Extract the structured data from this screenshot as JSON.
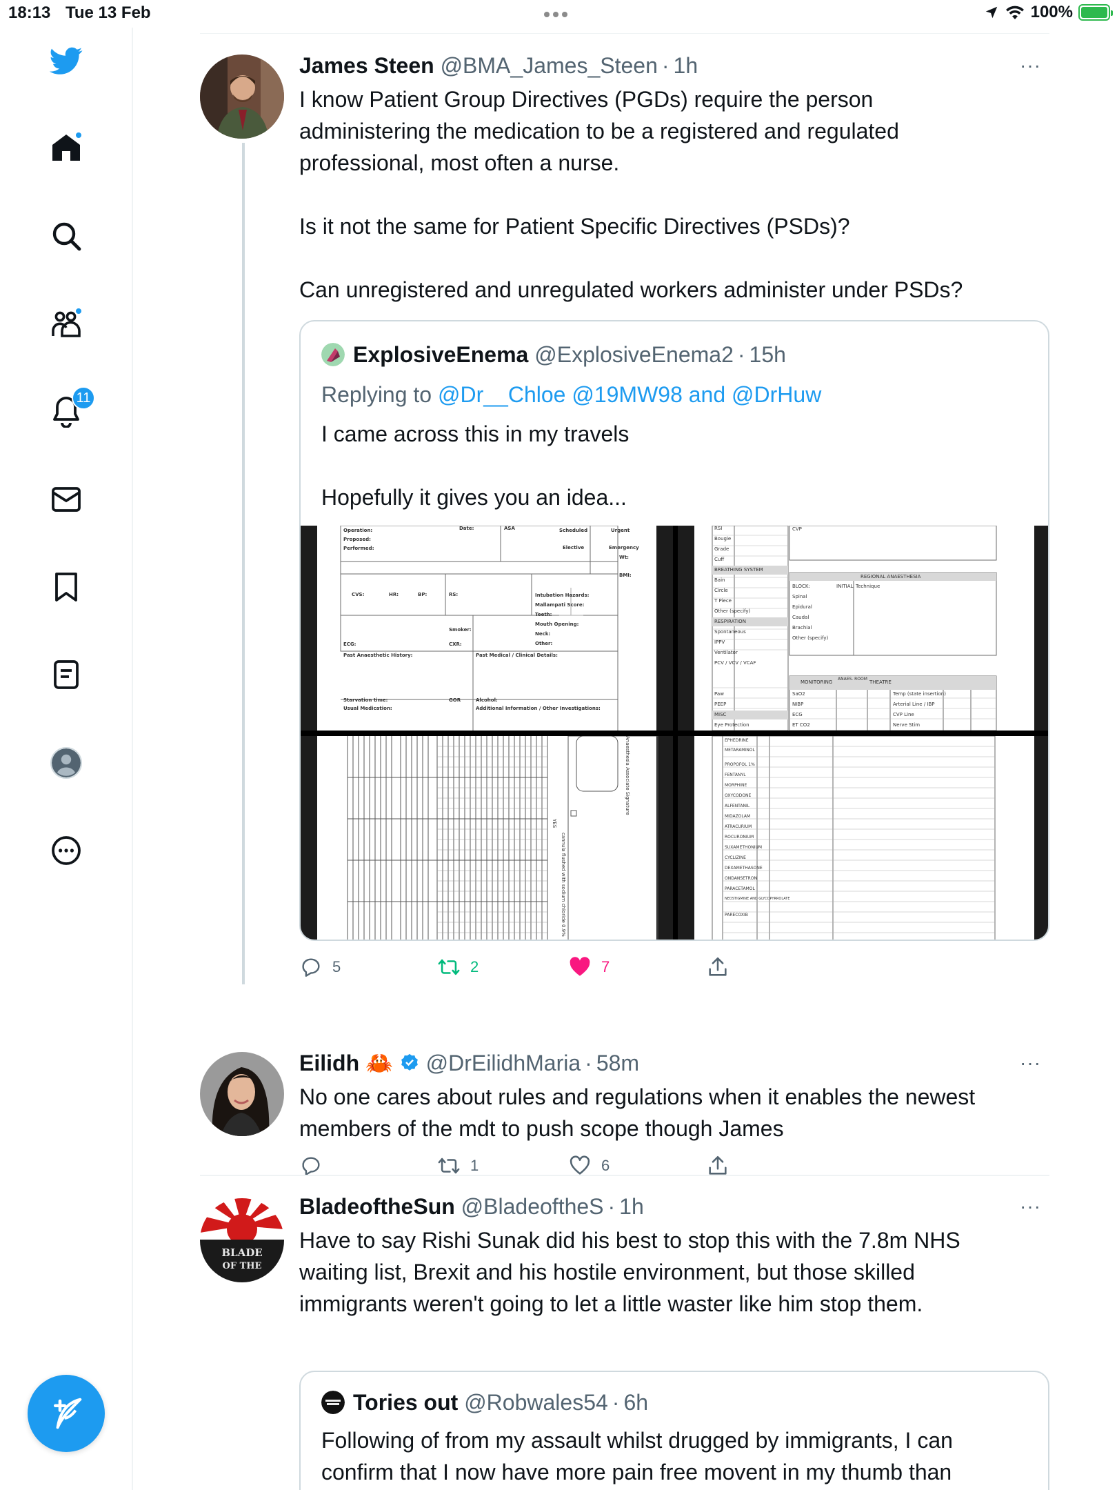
{
  "status_bar": {
    "time": "18:13",
    "date": "Tue 13 Feb",
    "battery": "100%",
    "battery_level": 1.0,
    "accent": "#2db94d"
  },
  "sidebar": {
    "items": [
      {
        "icon": "twitter-logo-icon"
      },
      {
        "icon": "home-icon",
        "has_dot": true
      },
      {
        "icon": "search-icon"
      },
      {
        "icon": "communities-icon",
        "has_dot": true
      },
      {
        "icon": "notifications-icon",
        "badge": "11"
      },
      {
        "icon": "messages-icon"
      },
      {
        "icon": "bookmark-icon"
      },
      {
        "icon": "lists-icon"
      },
      {
        "icon": "profile-icon"
      },
      {
        "icon": "more-icon"
      }
    ],
    "compose_icon": "compose-icon",
    "accent": "#1d9bf0"
  },
  "tweets": [
    {
      "name": "James Steen",
      "handle": "@BMA_James_Steen",
      "sep": "·",
      "time": "1h",
      "more": "···",
      "text": "I know Patient Group Directives (PGDs) require the person\nadministering the medication to be a registered and regulated\nprofessional, most often a nurse.\n\nIs it not the same for Patient Specific Directives (PSDs)?\n\nCan unregistered and unregulated workers administer under PSDs?",
      "quote": {
        "name": "ExplosiveEnema",
        "handle": "@ExplosiveEnema2",
        "sep": "·",
        "time": "15h",
        "replying_prefix": "Replying to",
        "replying_mentions": "@Dr__Chloe @19MW98 and @DrHuw",
        "text": "I came across this in my travels\n\nHopefully it gives you an idea..."
      },
      "actions": {
        "replies": "5",
        "retweets": "2",
        "likes": "7"
      }
    },
    {
      "name": "Eilidh",
      "emoji": "🦀",
      "verified": true,
      "handle": "@DrEilidhMaria",
      "sep": "·",
      "time": "58m",
      "more": "···",
      "text": "No one cares about rules and regulations when it enables the newest\nmembers of the mdt to push scope though James",
      "actions": {
        "replies": "",
        "retweets": "1",
        "likes": "6"
      }
    },
    {
      "name": "BladeoftheSun",
      "handle": "@BladeoftheS",
      "sep": "·",
      "time": "1h",
      "more": "···",
      "avatar_text": "BLADE OF THE",
      "text": "Have to say Rishi Sunak did his best to stop this with the 7.8m NHS\nwaiting list, Brexit and his hostile environment, but those skilled\nimmigrants weren't going to let a little waster like him stop them.",
      "quote": {
        "name": "Tories out",
        "handle": "@Robwales54",
        "sep": "·",
        "time": "6h",
        "text": "Following of from my assault whilst drugged by immigrants, I can\nconfirm that I now have more pain free movent in my thumb than\nI've had for years"
      }
    }
  ],
  "media_form": {
    "left_top": [
      "Operation:",
      "Proposed:",
      "Performed:",
      "Date:",
      "ASA",
      "Scheduled",
      "Urgent",
      "Elective",
      "Emergency",
      "Wt:",
      "BMI:",
      "CVS:",
      "HR:",
      "BP:",
      "RS:",
      "Intubation Hazards:",
      "Mallampati Score:",
      "Teeth:",
      "Mouth Opening:",
      "Neck:",
      "Other:",
      "Smoker:",
      "ECG:",
      "CXR:",
      "Past Anaesthetic History:",
      "Past Medical / Clinical Details:",
      "Starvation time:",
      "GOR",
      "Alcohol:",
      "Usual Medication:",
      "Additional Information / Other Investigations:"
    ],
    "right_top": [
      "RSI",
      "Bougie",
      "Grade",
      "Cuff",
      "BREATHING SYSTEM",
      "Bain",
      "Circle",
      "T Piece",
      "Other (specify)",
      "RESPIRATION",
      "Spontaneous",
      "IPPV",
      "Ventilator",
      "PCV / VCV / VCAF",
      "Paw",
      "PEEP",
      "MISC",
      "Eye Protection",
      "CVP",
      "REGIONAL ANAESTHESIA",
      "BLOCK:",
      "INITIAL",
      "Technique",
      "Spinal",
      "Epidural",
      "Caudal",
      "Brachial",
      "Other (specify)",
      "MONITORING",
      "ANAES. ROOM",
      "THEATRE",
      "SaO2",
      "NIBP",
      "ECG",
      "ET CO2",
      "Temp (state insertion)",
      "Arterial Line / IBP",
      "CVP Line",
      "Nerve Stim"
    ],
    "right_bottom": [
      "EPHEDRINE",
      "METARAMINOL",
      "PROPOFOL 1%",
      "FENTANYL",
      "MORPHINE",
      "OXYCODONE",
      "ALFENTANIL",
      "MIDAZOLAM",
      "ATRACURIUM",
      "ROCURONIUM",
      "SUXAMETHONIUM",
      "CYCLIZINE",
      "DEXAMETHASONE",
      "ONDANSETRON",
      "PARACETAMOL",
      "NEOSTIGMINE AND GLYCOPYRROLATE",
      "PARECOXIB"
    ],
    "left_bottom": [
      "YES",
      "Anaesthesia Associate Signature",
      "cannula flushed with sodium chloride 0.9%"
    ]
  }
}
